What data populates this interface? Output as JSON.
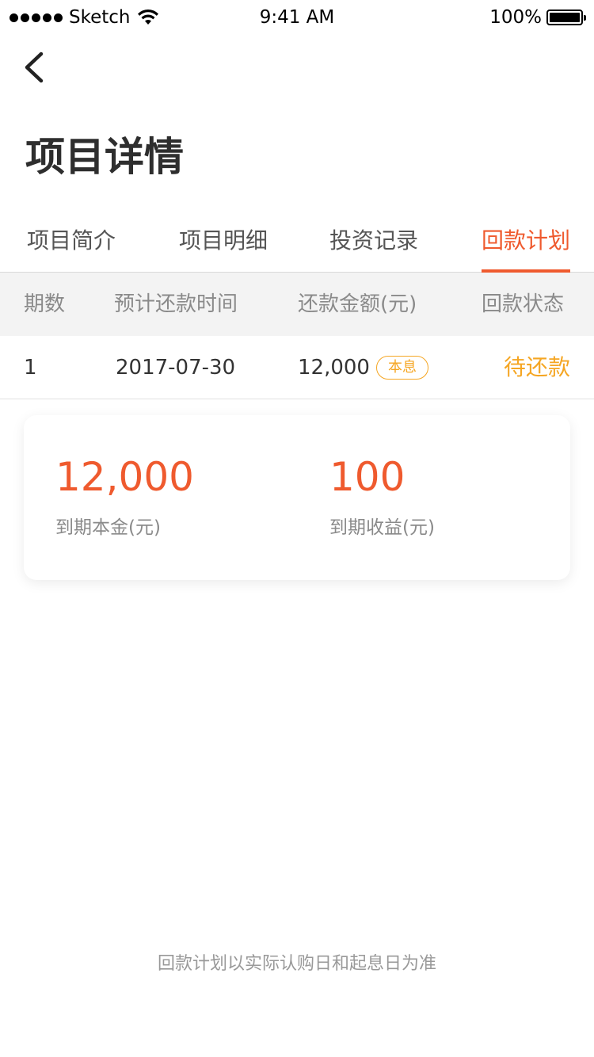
{
  "status_bar": {
    "carrier": "Sketch",
    "time": "9:41 AM",
    "battery": "100%"
  },
  "header": {
    "title": "项目详情"
  },
  "tabs": [
    {
      "label": "项目简介",
      "active": false
    },
    {
      "label": "项目明细",
      "active": false
    },
    {
      "label": "投资记录",
      "active": false
    },
    {
      "label": "回款计划",
      "active": true
    }
  ],
  "table": {
    "headers": [
      "期数",
      "预计还款时间",
      "还款金额(元)",
      "回款状态"
    ],
    "rows": [
      {
        "period": "1",
        "date": "2017-07-30",
        "amount": "12,000",
        "tag": "本息",
        "status": "待还款"
      }
    ]
  },
  "summary": {
    "principal_value": "12,000",
    "principal_label": "到期本金(元)",
    "income_value": "100",
    "income_label": "到期收益(元)"
  },
  "footnote": "回款计划以实际认购日和起息日为准",
  "colors": {
    "accent": "#ef5a2e",
    "warning": "#f5a623"
  }
}
